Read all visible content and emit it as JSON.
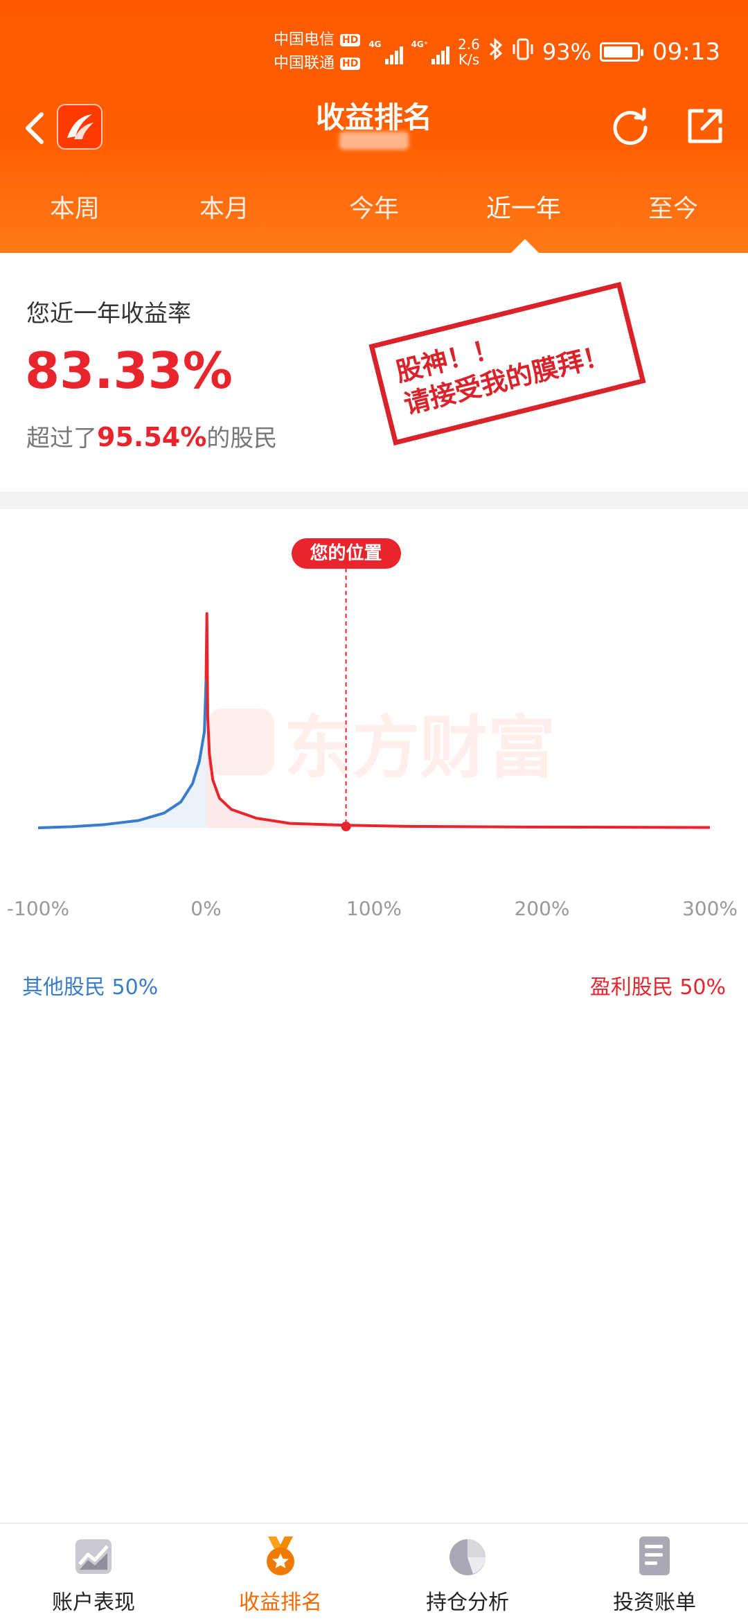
{
  "status_bar": {
    "carrier_1": "中国电信",
    "carrier_2": "中国联通",
    "hd_badge": "HD",
    "net_type_1": "4G",
    "net_type_2": "4G⁺",
    "net_speed_value": "2.6",
    "net_speed_unit": "K/s",
    "battery_percent": "93%",
    "time": "09:13"
  },
  "header": {
    "title": "收益排名"
  },
  "tabs": [
    {
      "label": "本周"
    },
    {
      "label": "本月"
    },
    {
      "label": "今年"
    },
    {
      "label": "近一年",
      "active": true
    },
    {
      "label": "至今"
    }
  ],
  "summary": {
    "label": "您近一年收益率",
    "value": "83.33%",
    "beat_prefix": "超过了",
    "beat_percent": "95.54%",
    "beat_suffix": "的股民",
    "stamp_line1": "股神！！",
    "stamp_line2": "请接受我的膜拜！"
  },
  "chart": {
    "marker_label": "您的位置",
    "watermark_text": "东方财富",
    "legend_left": "其他股民 50%",
    "legend_right": "盈利股民 50%",
    "colors": {
      "loss": "#3a7ccc",
      "profit": "#e8242c"
    }
  },
  "chart_data": {
    "type": "area",
    "x_ticks": [
      "-100%",
      "0%",
      "100%",
      "200%",
      "300%"
    ],
    "xlim": [
      -100,
      300
    ],
    "marker_x": 83.33,
    "series": [
      {
        "name": "其他股民",
        "color": "#3a7ccc",
        "x": [
          -100,
          -80,
          -60,
          -40,
          -25,
          -15,
          -8,
          -4,
          -1,
          0
        ],
        "y": [
          0.0,
          0.3,
          0.9,
          2.0,
          4.0,
          7.0,
          12.0,
          18.0,
          26.0,
          40.0
        ]
      },
      {
        "name": "盈利股民",
        "color": "#e8242c",
        "x": [
          0,
          0.5,
          1,
          2,
          4,
          8,
          15,
          30,
          50,
          83.33,
          120,
          200,
          300
        ],
        "y": [
          40.0,
          58.0,
          30.0,
          20.0,
          13.0,
          8.0,
          5.0,
          2.6,
          1.2,
          0.7,
          0.4,
          0.2,
          0.1
        ]
      }
    ]
  },
  "bottom_nav": [
    {
      "label": "账户表现",
      "icon": "chart-trend-icon"
    },
    {
      "label": "收益排名",
      "icon": "medal-icon",
      "active": true
    },
    {
      "label": "持仓分析",
      "icon": "pie-icon"
    },
    {
      "label": "投资账单",
      "icon": "document-icon"
    }
  ]
}
